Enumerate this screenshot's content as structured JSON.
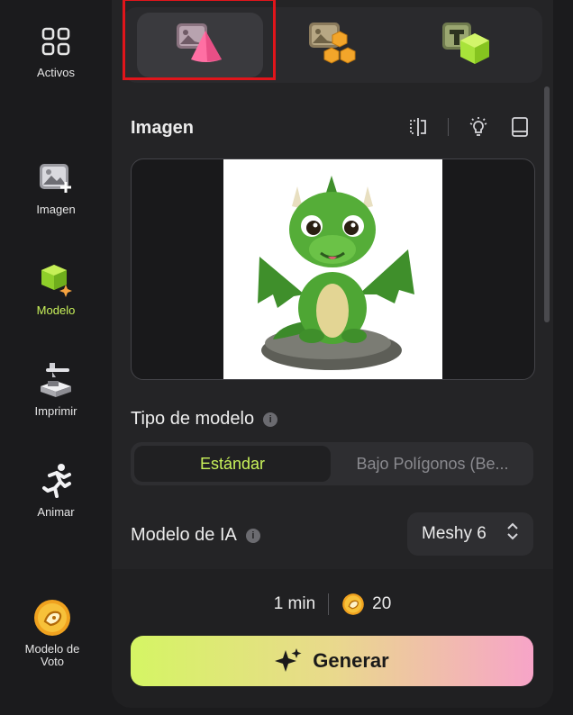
{
  "rail": {
    "items": [
      {
        "label": "Activos",
        "icon": "grid-icon"
      },
      {
        "label": "Imagen",
        "icon": "image-plus-icon"
      },
      {
        "label": "Modelo",
        "icon": "cube-sparkle-icon",
        "active": true
      },
      {
        "label": "Imprimir",
        "icon": "printer-3d-icon"
      },
      {
        "label": "Animar",
        "icon": "running-figure-icon"
      },
      {
        "label": "Modelo de Voto",
        "icon": "vote-coin-icon"
      }
    ]
  },
  "tabs": [
    {
      "name": "image-to-3d",
      "icon": "image-cone-icon",
      "selected": true
    },
    {
      "name": "multi-image-to-3d",
      "icon": "image-cubes-icon"
    },
    {
      "name": "text-to-3d",
      "icon": "text-cube-icon"
    }
  ],
  "image_section": {
    "title": "Imagen",
    "tools": [
      "split-view-icon",
      "lightbulb-icon",
      "book-icon"
    ],
    "preview_icon": "green-dragon-image"
  },
  "model_type": {
    "title": "Tipo de modelo",
    "options": [
      "Estándar",
      "Bajo Polígonos (Be..."
    ],
    "selected": "Estándar"
  },
  "ai_model": {
    "title": "Modelo de IA",
    "value": "Meshy 6"
  },
  "footer": {
    "time": "1 min",
    "credits": "20",
    "generate_label": "Generar"
  },
  "colors": {
    "accent": "#c9f25a",
    "highlight_box": "#e0151b",
    "gradient_start": "#d5f564",
    "gradient_end": "#f7a4c8"
  }
}
